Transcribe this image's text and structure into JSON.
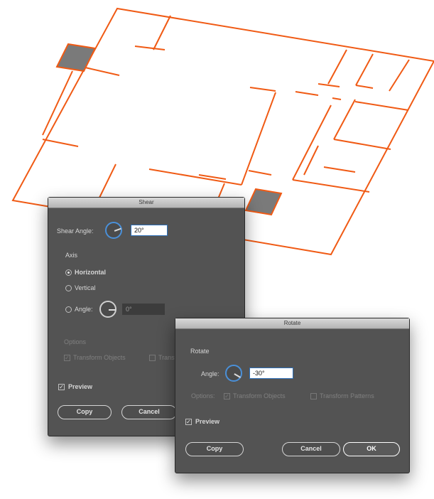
{
  "colors": {
    "plan_stroke": "#f05a14",
    "plan_fill": "#7a7a7a",
    "dialog_bg": "#535353",
    "accent": "#4a90d9"
  },
  "shear_dialog": {
    "title": "Shear",
    "shear_angle_label": "Shear Angle:",
    "shear_angle_value": "20°",
    "axis_heading": "Axis",
    "radio_horizontal": "Horizontal",
    "radio_vertical": "Vertical",
    "radio_angle": "Angle:",
    "axis_angle_value": "0°",
    "options_heading": "Options",
    "option_transform_objects": "Transform Objects",
    "option_transform_patterns": "Transf",
    "preview_label": "Preview",
    "copy_button": "Copy",
    "cancel_button": "Cancel"
  },
  "rotate_dialog": {
    "title": "Rotate",
    "rotate_heading": "Rotate",
    "angle_label": "Angle:",
    "angle_value": "-30°",
    "options_label": "Options:",
    "option_transform_objects": "Transform Objects",
    "option_transform_patterns": "Transform Patterns",
    "preview_label": "Preview",
    "copy_button": "Copy",
    "cancel_button": "Cancel",
    "ok_button": "OK"
  }
}
